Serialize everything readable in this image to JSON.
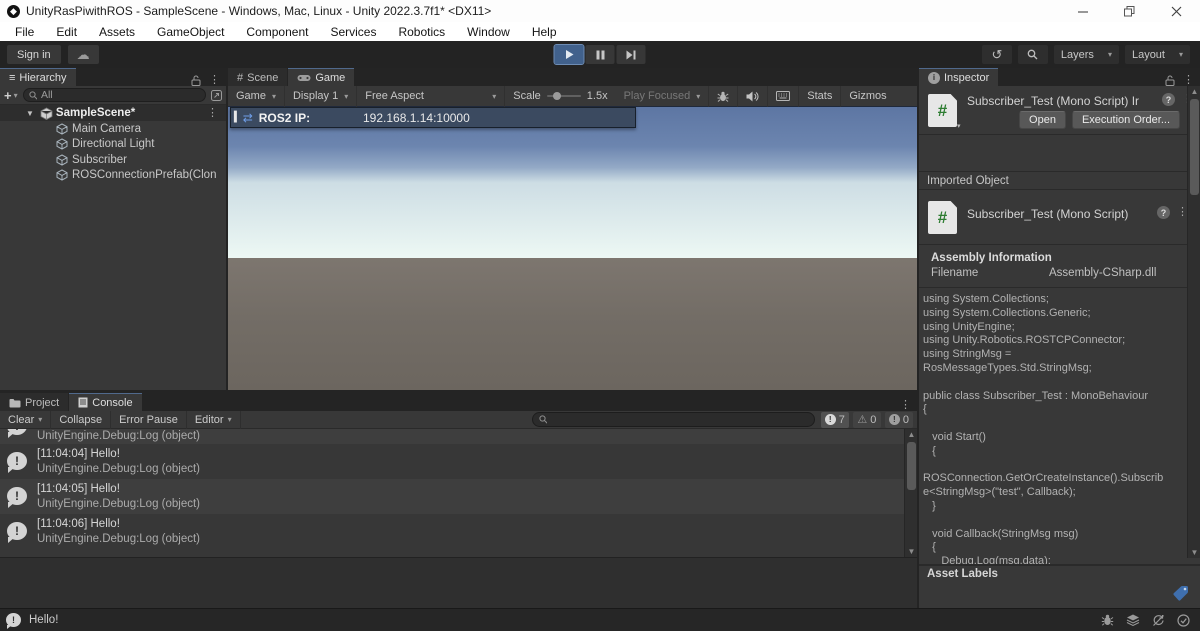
{
  "window": {
    "title": "UnityRasPiwithROS - SampleScene - Windows, Mac, Linux - Unity 2022.3.7f1* <DX11>",
    "menu_items": [
      "File",
      "Edit",
      "Assets",
      "GameObject",
      "Component",
      "Services",
      "Robotics",
      "Window",
      "Help"
    ]
  },
  "toolbar": {
    "sign_in_label": "Sign in",
    "layers_label": "Layers",
    "layout_label": "Layout"
  },
  "hierarchy": {
    "tab_label": "Hierarchy",
    "search_value": "All",
    "scene_name": "SampleScene*",
    "objects": [
      "Main Camera",
      "Directional Light",
      "Subscriber",
      "ROSConnectionPrefab(Clon"
    ]
  },
  "center": {
    "scene_tab": "Scene",
    "game_tab": "Game",
    "toolbar": {
      "game": "Game",
      "display": "Display 1",
      "aspect": "Free Aspect",
      "scale_label": "Scale",
      "scale_value": "1.5x",
      "play_focused": "Play Focused",
      "stats": "Stats",
      "gizmos": "Gizmos"
    },
    "hud": {
      "label": "ROS2 IP:",
      "value": "192.168.1.14:10000"
    }
  },
  "console": {
    "project_tab": "Project",
    "console_tab": "Console",
    "toolbar": {
      "clear": "Clear",
      "collapse": "Collapse",
      "error_pause": "Error Pause",
      "editor": "Editor"
    },
    "badges": {
      "info_count": "7",
      "warning_count": "0",
      "error_count": "0"
    },
    "partial_line": "UnityEngine.Debug:Log (object)",
    "entries": [
      {
        "message": "[11:04:04] Hello!",
        "trace": "UnityEngine.Debug:Log (object)"
      },
      {
        "message": "[11:04:05] Hello!",
        "trace": "UnityEngine.Debug:Log (object)"
      },
      {
        "message": "[11:04:06] Hello!",
        "trace": "UnityEngine.Debug:Log (object)"
      }
    ]
  },
  "inspector": {
    "tab_label": "Inspector",
    "importer_title": "Subscriber_Test (Mono Script) Ir",
    "open_button": "Open",
    "execution_order_button": "Execution Order...",
    "imported_object_label": "Imported Object",
    "script_title": "Subscriber_Test (Mono Script)",
    "assembly_information_label": "Assembly Information",
    "filename_label": "Filename",
    "filename_value": "Assembly-CSharp.dll",
    "code_lines": [
      "using System.Collections;",
      "using System.Collections.Generic;",
      "using UnityEngine;",
      "using Unity.Robotics.ROSTCPConnector;",
      "using StringMsg =",
      "RosMessageTypes.Std.StringMsg;",
      "",
      "public class Subscriber_Test : MonoBehaviour",
      "{",
      "",
      "   void Start()",
      "   {",
      "",
      "ROSConnection.GetOrCreateInstance().Subscrib",
      "e<StringMsg>(\"test\", Callback);",
      "   }",
      "",
      "   void Callback(StringMsg msg)",
      "   {",
      "      Debug.Log(msg.data);"
    ],
    "asset_labels_label": "Asset Labels"
  },
  "statusbar": {
    "message": "Hello!"
  },
  "colors": {
    "play_active": "#41618c",
    "hud_bg": "#3b4a60",
    "script_icon_green": "#2e7d32",
    "tag_blue": "#3f6fae",
    "sky_top": "#5d76a3",
    "sky_horizon": "#edf8f4",
    "ground": "#6f6962"
  }
}
